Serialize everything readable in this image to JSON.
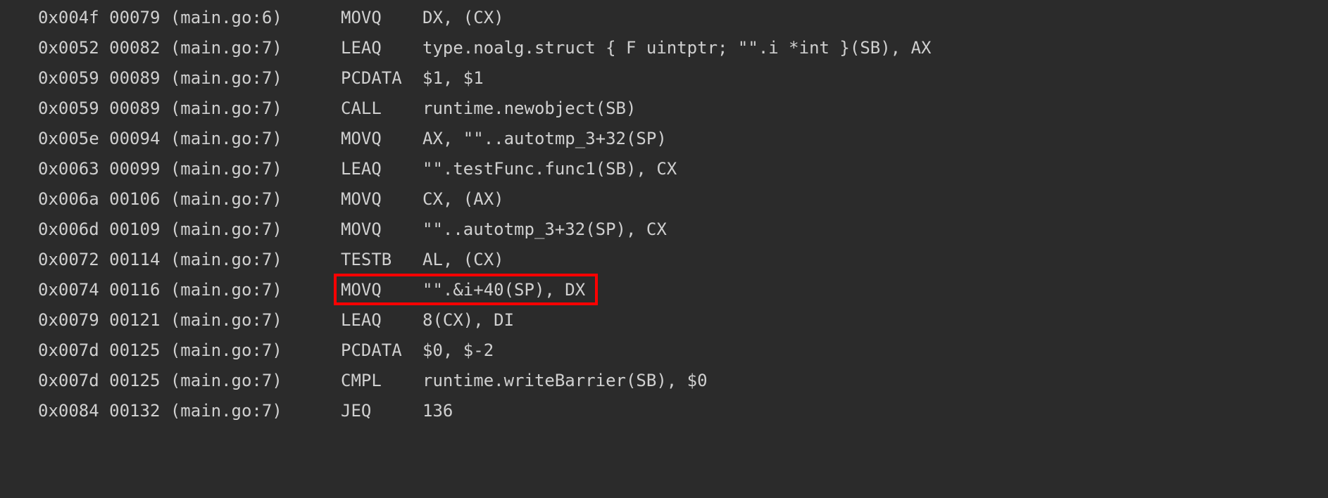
{
  "assembly": {
    "source_file": "main.go",
    "highlighted_index": 9,
    "lines": [
      {
        "hex": "0x004f",
        "dec": "00079",
        "src_line": 6,
        "mnemonic": "MOVQ",
        "operands": "DX, (CX)"
      },
      {
        "hex": "0x0052",
        "dec": "00082",
        "src_line": 7,
        "mnemonic": "LEAQ",
        "operands": "type.noalg.struct { F uintptr; \"\".i *int }(SB), AX"
      },
      {
        "hex": "0x0059",
        "dec": "00089",
        "src_line": 7,
        "mnemonic": "PCDATA",
        "operands": "$1, $1"
      },
      {
        "hex": "0x0059",
        "dec": "00089",
        "src_line": 7,
        "mnemonic": "CALL",
        "operands": "runtime.newobject(SB)"
      },
      {
        "hex": "0x005e",
        "dec": "00094",
        "src_line": 7,
        "mnemonic": "MOVQ",
        "operands": "AX, \"\"..autotmp_3+32(SP)"
      },
      {
        "hex": "0x0063",
        "dec": "00099",
        "src_line": 7,
        "mnemonic": "LEAQ",
        "operands": "\"\".testFunc.func1(SB), CX"
      },
      {
        "hex": "0x006a",
        "dec": "00106",
        "src_line": 7,
        "mnemonic": "MOVQ",
        "operands": "CX, (AX)"
      },
      {
        "hex": "0x006d",
        "dec": "00109",
        "src_line": 7,
        "mnemonic": "MOVQ",
        "operands": "\"\"..autotmp_3+32(SP), CX"
      },
      {
        "hex": "0x0072",
        "dec": "00114",
        "src_line": 7,
        "mnemonic": "TESTB",
        "operands": "AL, (CX)"
      },
      {
        "hex": "0x0074",
        "dec": "00116",
        "src_line": 7,
        "mnemonic": "MOVQ",
        "operands": "\"\".&i+40(SP), DX"
      },
      {
        "hex": "0x0079",
        "dec": "00121",
        "src_line": 7,
        "mnemonic": "LEAQ",
        "operands": "8(CX), DI"
      },
      {
        "hex": "0x007d",
        "dec": "00125",
        "src_line": 7,
        "mnemonic": "PCDATA",
        "operands": "$0, $-2"
      },
      {
        "hex": "0x007d",
        "dec": "00125",
        "src_line": 7,
        "mnemonic": "CMPL",
        "operands": "runtime.writeBarrier(SB), $0"
      },
      {
        "hex": "0x0084",
        "dec": "00132",
        "src_line": 7,
        "mnemonic": "JEQ",
        "operands": "136"
      }
    ]
  }
}
